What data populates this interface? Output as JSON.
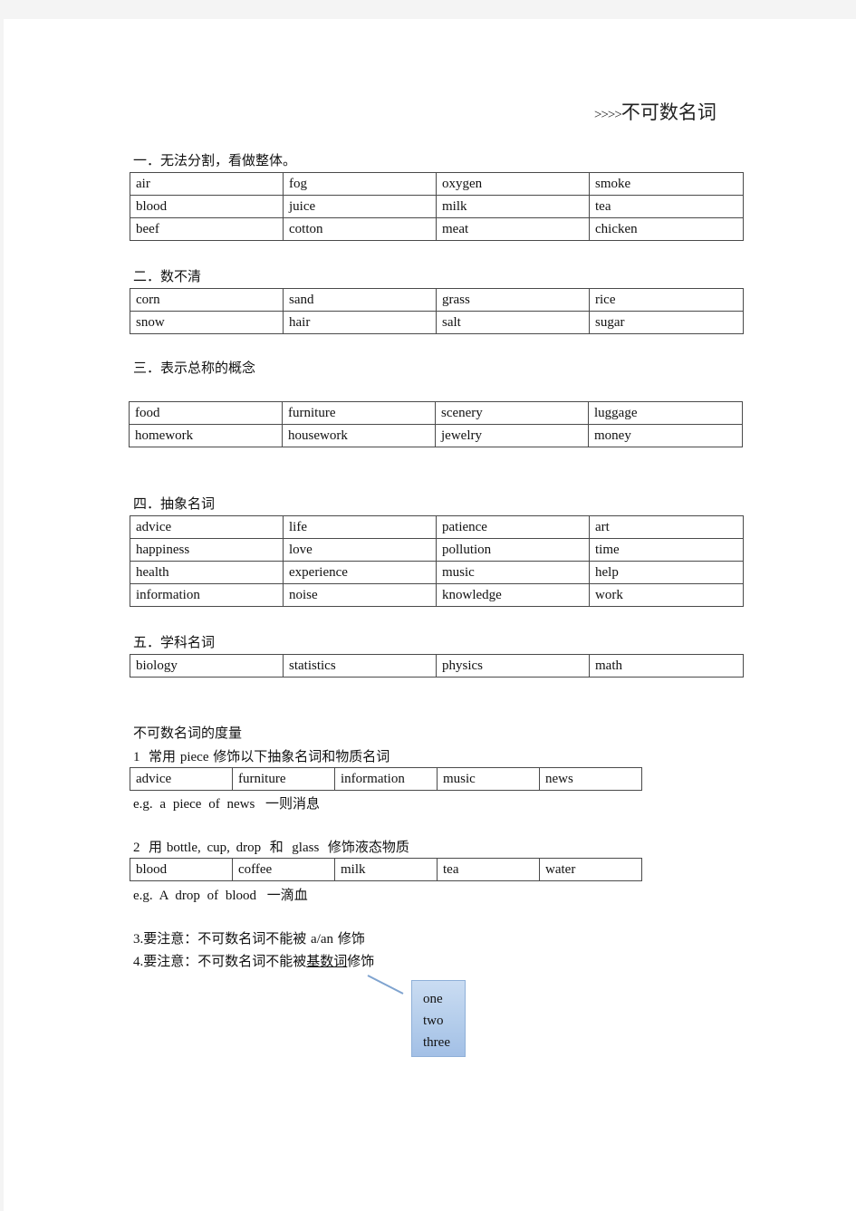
{
  "title": {
    "arrows": ">>>>",
    "text": "不可数名词"
  },
  "sections": [
    {
      "heading": "一．无法分割，看做整体。",
      "rows": [
        [
          "air",
          "fog",
          "oxygen",
          "smoke"
        ],
        [
          "blood",
          "juice",
          "milk",
          "tea"
        ],
        [
          "beef",
          "cotton",
          "meat",
          "chicken"
        ]
      ]
    },
    {
      "heading": "二．数不清",
      "rows": [
        [
          "corn",
          "sand",
          "grass",
          "rice"
        ],
        [
          "snow",
          "hair",
          "salt",
          "sugar"
        ]
      ]
    },
    {
      "heading": "三．表示总称的概念",
      "rows": [
        [
          "food",
          "furniture",
          "scenery",
          "luggage"
        ],
        [
          "homework",
          "housework",
          "jewelry",
          "money"
        ]
      ]
    },
    {
      "heading": "四．抽象名词",
      "rows": [
        [
          "advice",
          "life",
          "patience",
          "art"
        ],
        [
          "happiness",
          "love",
          "pollution",
          "time"
        ],
        [
          "health",
          "experience",
          "music",
          "help"
        ],
        [
          "information",
          "noise",
          "knowledge",
          "work"
        ]
      ]
    },
    {
      "heading": "五．学科名词",
      "rows": [
        [
          "biology",
          "statistics",
          "physics",
          "math"
        ]
      ]
    }
  ],
  "measurement": {
    "heading": "不可数名词的度量",
    "rule1": {
      "num": "1",
      "pre": "常用",
      "word": "piece",
      "post": "修饰以下抽象名词和物质名词",
      "cells": [
        "advice",
        "furniture",
        "information",
        "music",
        "news"
      ],
      "example_en": "e.g. a piece of news",
      "example_zh": "一则消息"
    },
    "rule2": {
      "num": "2",
      "pre": "用",
      "words": "bottle, cup, drop",
      "and": "和",
      "word2": "glass",
      "post": "修饰液态物质",
      "cells": [
        "blood",
        "coffee",
        "milk",
        "tea",
        "water"
      ],
      "example_en": "e.g. A drop of blood",
      "example_zh": "一滴血"
    },
    "rule3": {
      "num": "3.",
      "pre": "要注意：不可数名词不能被",
      "word": "a/an",
      "post": "修饰"
    },
    "rule4": {
      "num": "4.",
      "pre": "要注意：不可数名词不能被",
      "underlined": "基数词",
      "post": "修饰"
    },
    "callout": {
      "items": [
        "one",
        "two",
        "three"
      ]
    }
  }
}
